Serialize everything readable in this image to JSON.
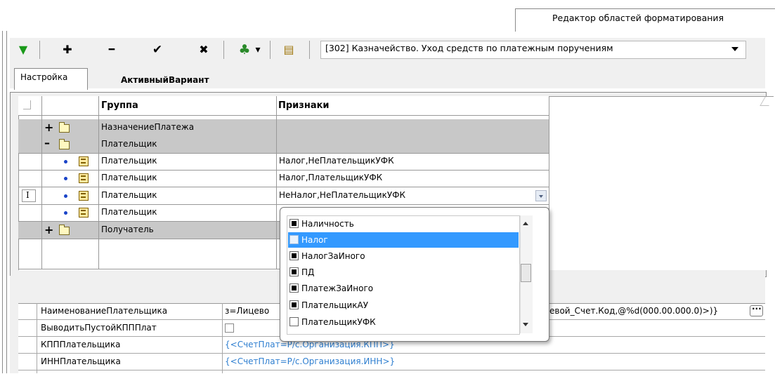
{
  "window": {
    "tab_label": "Редактор областей форматирования"
  },
  "toolbar": {
    "filter_glyph": "▼",
    "add_glyph": "✚",
    "remove_glyph": "━",
    "apply_glyph": "✔",
    "cancel_glyph": "✖",
    "tree_glyph": "♣",
    "tree_arrow_glyph": "▾",
    "open_glyph": "▤",
    "variant_value": "[302] Казначейство. Уход средств по платежным поручениям"
  },
  "tabs": {
    "settings": "Настройка",
    "active_variant": "АктивныйВариант"
  },
  "grid": {
    "headers": {
      "group": "Группа",
      "features": "Признаки"
    },
    "rows": [
      {
        "type": "group",
        "expand": "+",
        "name": "НазначениеПлатежа",
        "features": ""
      },
      {
        "type": "group",
        "expand": "–",
        "name": "Плательщик",
        "features": ""
      },
      {
        "type": "item",
        "name": "Плательщик",
        "features": "Налог,НеПлательщикУФК"
      },
      {
        "type": "item",
        "name": "Плательщик",
        "features": "Налог,ПлательщикУФК"
      },
      {
        "type": "item",
        "name": "Плательщик",
        "features": "НеНалог,НеПлательщикУФК",
        "cursor": "I"
      },
      {
        "type": "item",
        "name": "Плательщик",
        "features": ""
      },
      {
        "type": "group",
        "expand": "+",
        "name": "Получатель",
        "features": ""
      }
    ]
  },
  "dropdown": {
    "options": [
      {
        "label": "Наличность",
        "checked": true,
        "selected": false
      },
      {
        "label": "Налог",
        "checked": false,
        "selected": true
      },
      {
        "label": "НалогЗаИного",
        "checked": true,
        "selected": false
      },
      {
        "label": "ПД",
        "checked": true,
        "selected": false
      },
      {
        "label": "ПлатежЗаИного",
        "checked": true,
        "selected": false
      },
      {
        "label": "ПлательщикАУ",
        "checked": true,
        "selected": false
      },
      {
        "label": "ПлательщикУФК",
        "checked": false,
        "selected": false
      }
    ]
  },
  "properties": [
    {
      "name": "НаименованиеПлательщика",
      "value_left": "з=Лицево",
      "value_right": "евой_Счет.Код,@%d(000.00.000.0)>)}",
      "more": "···"
    },
    {
      "name": "ВыводитьПустойКПППлат",
      "value_left": "",
      "value_right": ""
    },
    {
      "name": "КПППлательщика",
      "value_left": "{<СчетПлат=Р/с.Организация.КПП>}",
      "value_right": ""
    },
    {
      "name": "ИННПлательщика",
      "value_left": "{<СчетПлат=Р/с.Организация.ИНН>}",
      "value_right": ""
    }
  ]
}
